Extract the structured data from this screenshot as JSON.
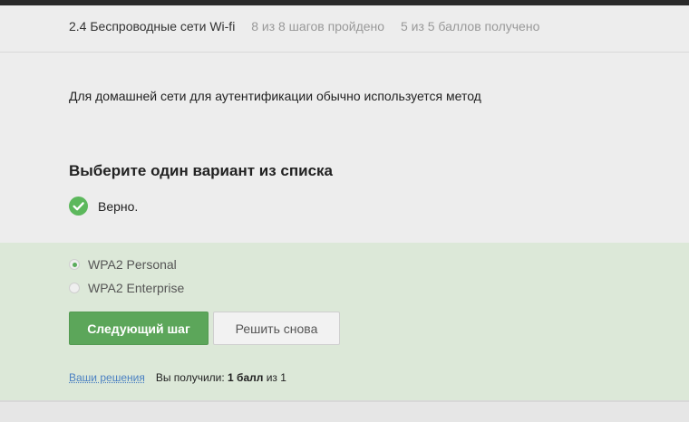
{
  "header": {
    "lesson_title": "2.4 Беспроводные сети Wi-fi",
    "steps_progress": "8 из 8 шагов пройдено",
    "score_progress": "5 из 5 баллов  получено"
  },
  "question": {
    "text": "Для домашней сети для аутентификации обычно используется метод",
    "prompt": "Выберите один вариант из списка",
    "result_label": "Верно.",
    "result_icon": "check-circle-icon",
    "result_color": "#5cb85c"
  },
  "options": [
    {
      "label": "WPA2 Personal",
      "selected": true
    },
    {
      "label": "WPA2 Enterprise",
      "selected": false
    }
  ],
  "actions": {
    "next_label": "Следующий шаг",
    "retry_label": "Решить снова"
  },
  "footer": {
    "solutions_link": "Ваши решения",
    "score_prefix": "Вы получили: ",
    "score_value": "1 балл",
    "score_suffix": " из 1"
  },
  "colors": {
    "accent_green": "#5ca65a",
    "panel_bg": "#dce8d8",
    "link_blue": "#4a80c2"
  }
}
